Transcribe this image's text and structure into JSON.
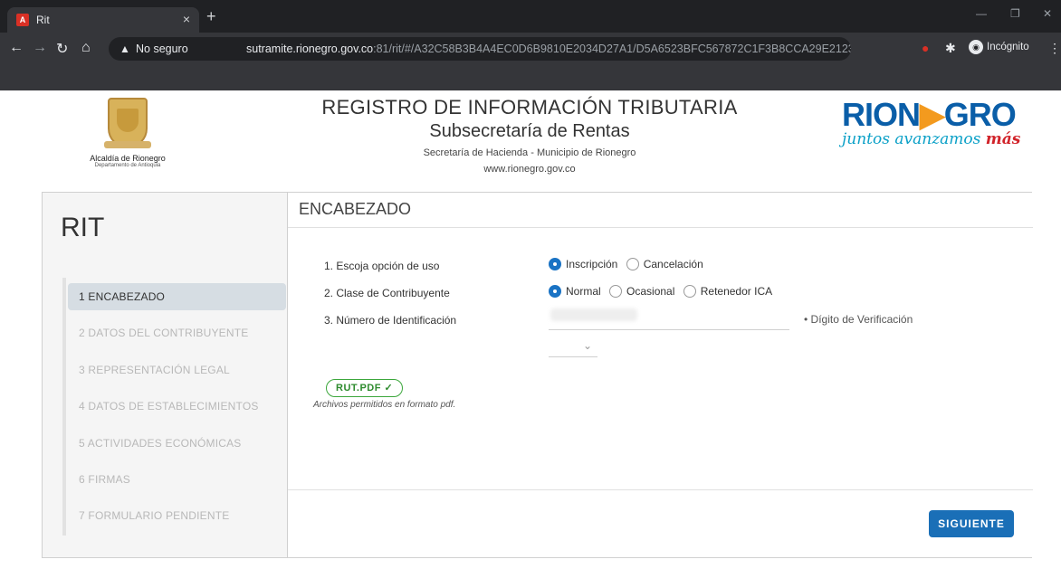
{
  "browser": {
    "tab_title": "Rit",
    "tab_favicon": "A",
    "security_label": "No seguro",
    "url_host": "sutramite.rionegro.gov.co",
    "url_path": ":81/rit/#/A32C58B3B4A4EC0D6B9810E2034D27A1/D5A6523BFC567872C1F3B8CCA29E2123",
    "incognito_label": "Incógnito"
  },
  "header": {
    "left_logo_line1": "Alcaldía de Rionegro",
    "left_logo_line2": "Departamento de Antioquia",
    "title": "REGISTRO DE INFORMACIÓN TRIBUTARIA",
    "subtitle": "Subsecretaría de Rentas",
    "department": "Secretaría de Hacienda - Municipio de Rionegro",
    "website": "www.rionegro.gov.co",
    "brand_part1": "RION",
    "brand_part2": "GRO",
    "slogan": "juntos avanzamos",
    "slogan_accent": "más"
  },
  "sidebar": {
    "title": "RIT",
    "items": [
      {
        "label": "1 ENCABEZADO"
      },
      {
        "label": "2 DATOS DEL CONTRIBUYENTE"
      },
      {
        "label": "3 REPRESENTACIÓN LEGAL"
      },
      {
        "label": "4 DATOS DE ESTABLECIMIENTOS"
      },
      {
        "label": "5 ACTIVIDADES ECONÓMICAS"
      },
      {
        "label": "6 FIRMAS"
      },
      {
        "label": "7 FORMULARIO PENDIENTE"
      }
    ]
  },
  "form": {
    "section_title": "ENCABEZADO",
    "q1_label": "1. Escoja opción de uso",
    "q1_options": [
      "Inscripción",
      "Cancelación"
    ],
    "q2_label": "2. Clase de Contribuyente",
    "q2_options": [
      "Normal",
      "Ocasional",
      "Retenedor ICA"
    ],
    "q3_label": "3. Número de Identificación",
    "dv_label": "• Dígito de Verificación",
    "file_chip": "RUT.PDF ✓",
    "file_hint": "Archivos permitidos en formato pdf.",
    "next_button": "SIGUIENTE"
  },
  "colors": {
    "accent": "#1a6fb7",
    "success": "#3ca73c",
    "brand_blue": "#0a5ea8",
    "brand_orange": "#f39a1e"
  }
}
